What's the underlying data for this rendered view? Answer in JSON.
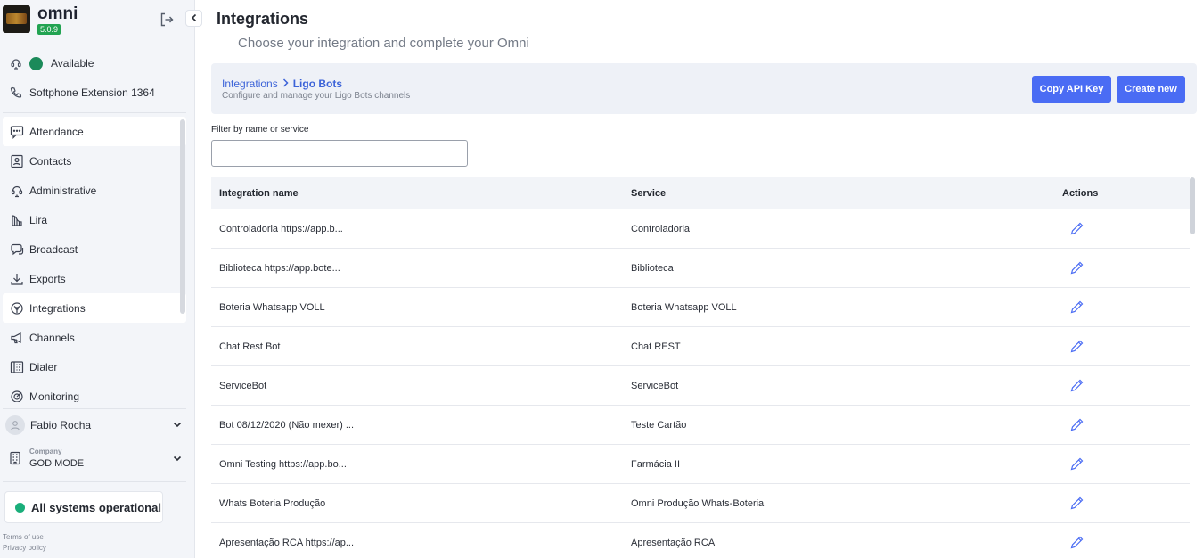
{
  "app": {
    "name": "omni",
    "version": "5.0.9"
  },
  "sidebar": {
    "status": {
      "label": "Available",
      "color": "#1b8a5a"
    },
    "softphone": "Softphone Extension 1364",
    "nav": [
      {
        "label": "Attendance",
        "icon": "chat-bubble-icon",
        "active": true
      },
      {
        "label": "Contacts",
        "icon": "contacts-card-icon",
        "active": false
      },
      {
        "label": "Administrative",
        "icon": "headset-icon",
        "active": false
      },
      {
        "label": "Lira",
        "icon": "lira-harp-icon",
        "active": false
      },
      {
        "label": "Broadcast",
        "icon": "broadcast-icon",
        "active": false
      },
      {
        "label": "Exports",
        "icon": "download-icon",
        "active": false
      },
      {
        "label": "Integrations",
        "icon": "integrations-icon",
        "active": true
      },
      {
        "label": "Channels",
        "icon": "megaphone-icon",
        "active": false
      },
      {
        "label": "Dialer",
        "icon": "dialer-icon",
        "active": false
      },
      {
        "label": "Monitoring",
        "icon": "monitoring-icon",
        "active": false
      }
    ],
    "user": {
      "name": "Fabio Rocha"
    },
    "company": {
      "label": "Company",
      "name": "GOD MODE"
    },
    "system_status": "All systems operational",
    "footer": {
      "terms": "Terms of use",
      "privacy": "Privacy policy"
    }
  },
  "page": {
    "title": "Integrations",
    "subtitle": "Choose your integration and complete your Omni"
  },
  "header_card": {
    "breadcrumb_root": "Integrations",
    "breadcrumb_current": "Ligo Bots",
    "description": "Configure and manage your Ligo Bots channels",
    "copy_api_key": "Copy API Key",
    "create_new": "Create new"
  },
  "filter": {
    "label": "Filter by name or service",
    "value": ""
  },
  "table": {
    "headers": {
      "name": "Integration name",
      "service": "Service",
      "actions": "Actions"
    },
    "rows": [
      {
        "name": "Controladoria https://app.b...",
        "service": "Controladoria"
      },
      {
        "name": "Biblioteca https://app.bote...",
        "service": "Biblioteca"
      },
      {
        "name": "Boteria Whatsapp VOLL",
        "service": "Boteria Whatsapp VOLL"
      },
      {
        "name": "Chat Rest Bot",
        "service": "Chat REST"
      },
      {
        "name": "ServiceBot",
        "service": "ServiceBot"
      },
      {
        "name": "Bot 08/12/2020 (Não mexer) ...",
        "service": "Teste Cartão"
      },
      {
        "name": "Omni Testing https://app.bo...",
        "service": "Farmácia II"
      },
      {
        "name": "Whats Boteria Produção",
        "service": "Omni Produção Whats-Boteria"
      },
      {
        "name": "Apresentação RCA https://ap...",
        "service": "Apresentação RCA"
      }
    ]
  },
  "colors": {
    "accent": "#4a6cf4",
    "link": "#3c63d8",
    "ok": "#1aae7a"
  }
}
